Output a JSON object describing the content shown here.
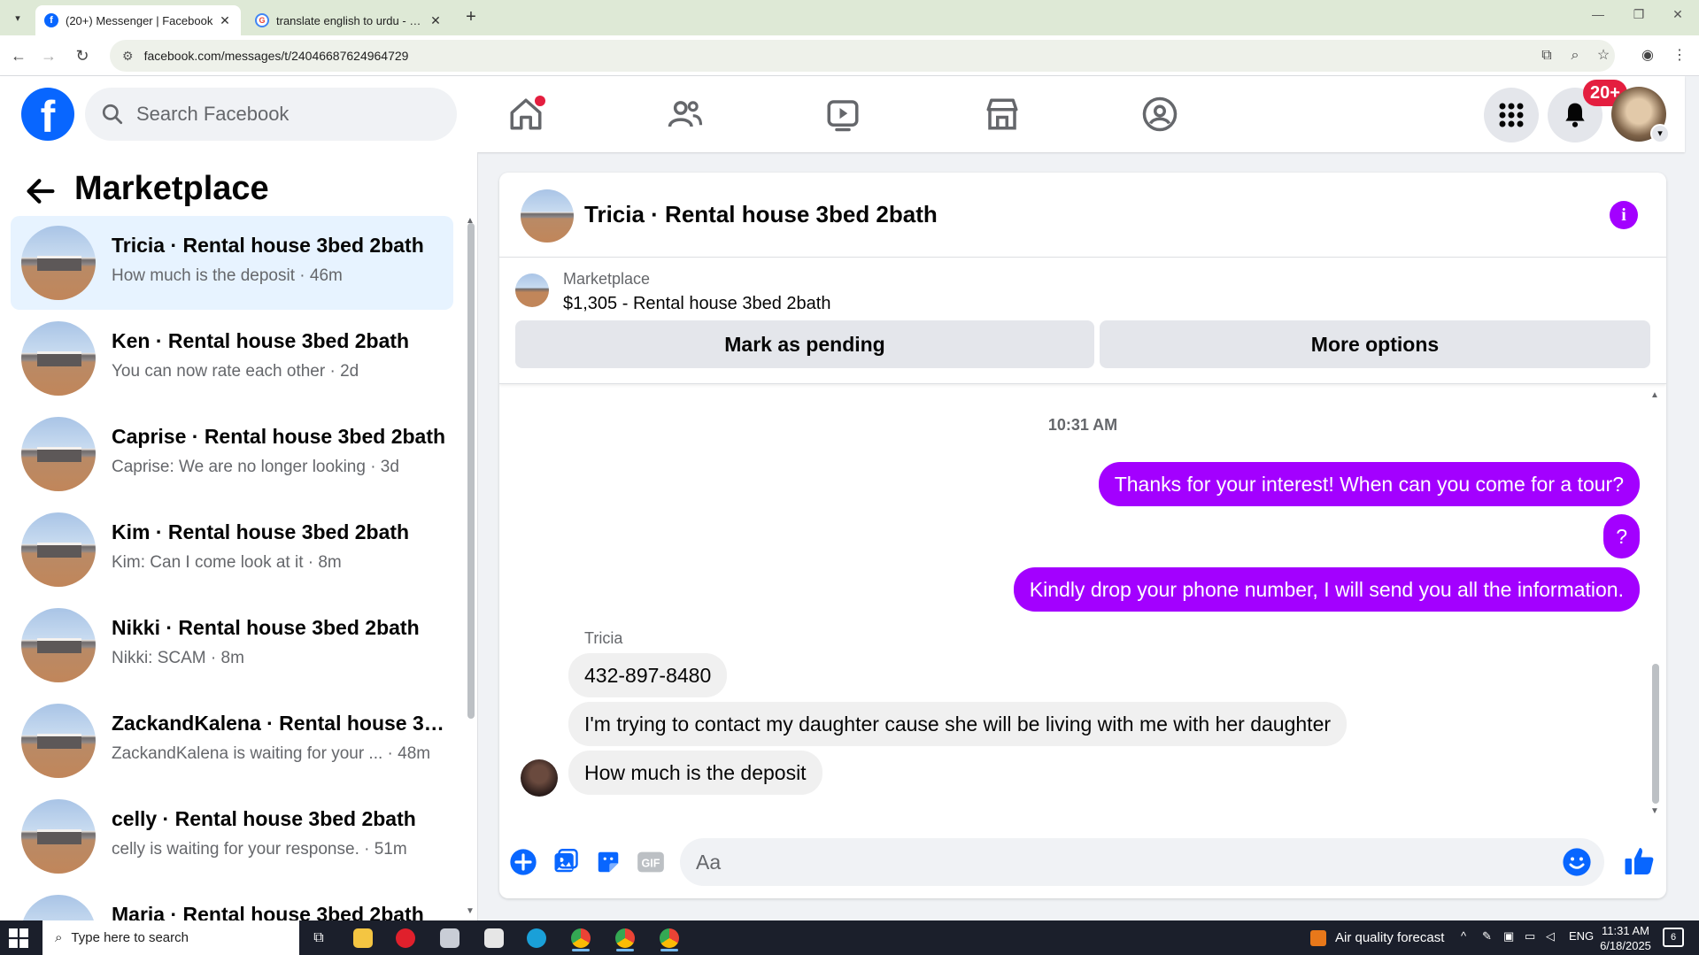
{
  "browser": {
    "tabs": [
      {
        "title": "(20+) Messenger | Facebook",
        "active": true,
        "icon": "facebook-icon"
      },
      {
        "title": "translate english to urdu - Goo",
        "active": false,
        "icon": "google-icon"
      }
    ],
    "url": "facebook.com/messages/t/24046687624964729"
  },
  "fb_header": {
    "logo_letter": "f",
    "search_placeholder": "Search Facebook",
    "notification_badge": "20+",
    "nav_icons": [
      "home-icon",
      "friends-icon",
      "watch-icon",
      "marketplace-icon",
      "groups-icon"
    ]
  },
  "sidebar": {
    "title": "Marketplace",
    "conversations": [
      {
        "title": "Tricia · Rental house 3bed 2bath",
        "subtitle": "How much is the deposit · 46m",
        "selected": true
      },
      {
        "title": "Ken · Rental house 3bed 2bath",
        "subtitle": "You can now rate each other · 2d",
        "selected": false
      },
      {
        "title": "Caprise · Rental house 3bed 2bath",
        "subtitle": "Caprise: We are no longer looking · 3d",
        "selected": false
      },
      {
        "title": "Kim · Rental house 3bed 2bath",
        "subtitle": "Kim: Can I come look at it · 8m",
        "selected": false
      },
      {
        "title": "Nikki · Rental house 3bed 2bath",
        "subtitle": "Nikki: SCAM · 8m",
        "selected": false
      },
      {
        "title": "ZackandKalena · Rental house 3b...",
        "subtitle": "ZackandKalena is waiting for your ... · 48m",
        "selected": false
      },
      {
        "title": "celly · Rental house 3bed 2bath",
        "subtitle": "celly is waiting for your response. · 51m",
        "selected": false
      },
      {
        "title": "Maria · Rental house 3bed 2bath",
        "subtitle": "",
        "selected": false
      }
    ]
  },
  "chat": {
    "title": "Tricia · Rental house 3bed 2bath",
    "marketplace_label": "Marketplace",
    "listing": "$1,305 - Rental house 3bed 2bath",
    "buttons": {
      "pending": "Mark as pending",
      "more": "More options"
    },
    "timestamp": "10:31 AM",
    "sender_name": "Tricia",
    "messages": [
      {
        "direction": "out",
        "text": "Thanks for your interest! When can you come for a tour?"
      },
      {
        "direction": "out",
        "text": "?"
      },
      {
        "direction": "out",
        "text": "Kindly drop your phone number, I will send you all the information."
      },
      {
        "direction": "in",
        "text": "432-897-8480"
      },
      {
        "direction": "in",
        "text": "I'm trying to contact my daughter cause she will be living with me with her daughter"
      },
      {
        "direction": "in",
        "text": "How much is the deposit"
      }
    ],
    "composer_placeholder": "Aa",
    "accent_color": "#a300ff"
  },
  "taskbar": {
    "search_placeholder": "Type here to search",
    "weather": "Air quality forecast",
    "language": "ENG",
    "time": "11:31 AM",
    "date": "6/18/2025",
    "notification_count": "6"
  }
}
